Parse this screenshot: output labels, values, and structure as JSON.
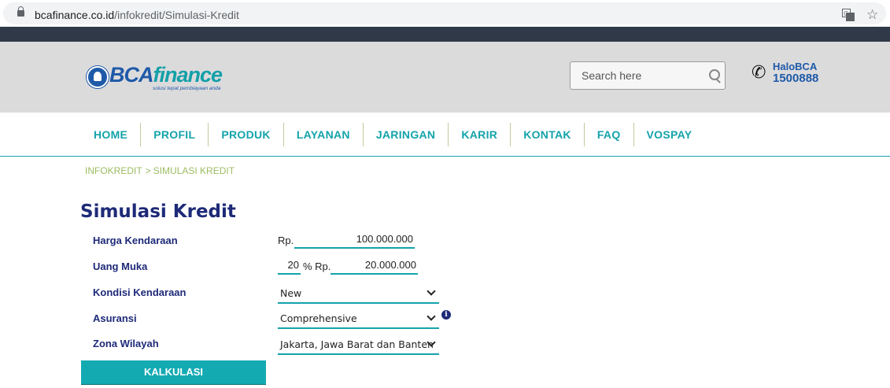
{
  "browser": {
    "url_domain": "bcafinance.co.id",
    "url_path": "/infokredit/Simulasi-Kredit"
  },
  "header": {
    "logo_bca": "BCA",
    "logo_finance": "finance",
    "logo_tagline": "solusi tepat pembiayaan anda",
    "search_placeholder": "Search here",
    "halo_label": "HaloBCA",
    "halo_number": "1500888"
  },
  "nav": {
    "items": [
      "HOME",
      "PROFIL",
      "PRODUK",
      "LAYANAN",
      "JARINGAN",
      "KARIR",
      "KONTAK",
      "FAQ",
      "VOSPAY"
    ]
  },
  "breadcrumb": {
    "parent": "INFOKREDIT",
    "separator": ">",
    "current": "SIMULASI KREDIT"
  },
  "form": {
    "title": "Simulasi Kredit",
    "harga_label": "Harga Kendaraan",
    "harga_prefix": "Rp.",
    "harga_value": "100.000.000",
    "uang_muka_label": "Uang Muka",
    "uang_muka_percent": "20",
    "uang_muka_middle": "% Rp.",
    "uang_muka_value": "20.000.000",
    "kondisi_label": "Kondisi Kendaraan",
    "kondisi_value": "New",
    "asuransi_label": "Asuransi",
    "asuransi_value": "Comprehensive",
    "zona_label": "Zona Wilayah",
    "zona_value": "Jakarta, Jawa Barat dan Banten",
    "submit_label": "KALKULASI",
    "info_symbol": "i"
  },
  "colors": {
    "accent": "#14a3ab",
    "title_navy": "#1e2a78",
    "header_bg": "#dcdbdc",
    "top_bar": "#2f3947",
    "breadcrumb": "#9cbc62"
  }
}
